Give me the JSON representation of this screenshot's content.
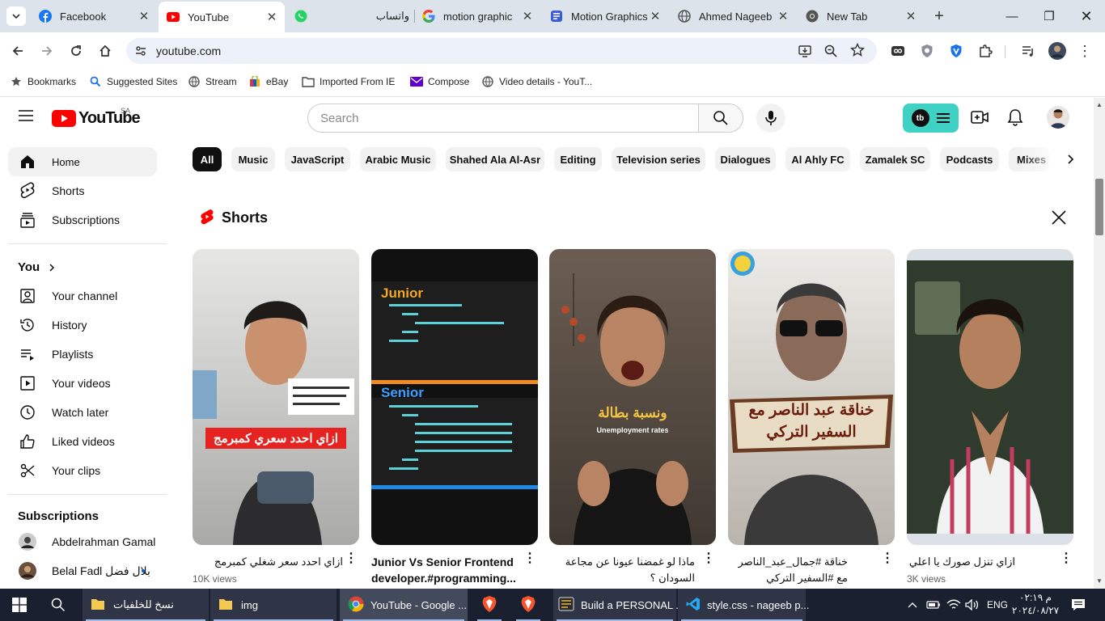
{
  "browser": {
    "tabs": [
      {
        "label": "Facebook",
        "icon": "facebook-icon"
      },
      {
        "label": "YouTube",
        "icon": "youtube-icon",
        "active": true
      },
      {
        "label": "واتساب",
        "icon": "whatsapp-icon"
      },
      {
        "label": "motion graphic",
        "icon": "google-icon"
      },
      {
        "label": "Motion Graphics",
        "icon": "document-icon"
      },
      {
        "label": "Ahmed Nageeb",
        "icon": "globe-icon"
      },
      {
        "label": "New Tab",
        "icon": "chrome-icon"
      }
    ],
    "url": "youtube.com",
    "bookmarks": [
      "Bookmarks",
      "Suggested Sites",
      "Stream",
      "eBay",
      "Imported From IE",
      "Compose",
      "Video details - YouT..."
    ]
  },
  "youtube": {
    "country": "SA",
    "search_placeholder": "Search",
    "sidebar": {
      "main": [
        "Home",
        "Shorts",
        "Subscriptions"
      ],
      "you_label": "You",
      "you_items": [
        "Your channel",
        "History",
        "Playlists",
        "Your videos",
        "Watch later",
        "Liked videos",
        "Your clips"
      ],
      "subscriptions_label": "Subscriptions",
      "subscriptions": [
        {
          "name": "Abdelrahman Gamal"
        },
        {
          "name": "Belal Fadl بلال فضل"
        }
      ]
    },
    "chips": [
      "All",
      "Music",
      "JavaScript",
      "Arabic Music",
      "Shahed Ala Al-Asr",
      "Editing",
      "Television series",
      "Dialogues",
      "Al Ahly FC",
      "Zamalek SC",
      "Podcasts",
      "Mixes"
    ],
    "shorts_label": "Shorts",
    "shorts": [
      {
        "title": "ازاي احدد سعر شغلي كمبرمج",
        "views": "10K views",
        "overlay": "ازاي احدد سعري كمبرمج",
        "rtl": true
      },
      {
        "title": "Junior Vs Senior Frontend developer.#programming...",
        "views": "",
        "overlay_top": "Junior",
        "overlay_bottom": "Senior",
        "rtl": false
      },
      {
        "title": "ماذا لو غمضنا عيونا عن مجاعة السودان ؟",
        "views": "",
        "overlay": "ونسبة بطالة",
        "overlay_sub": "Unemployment rates",
        "rtl": true
      },
      {
        "title": "خناقة #جمال_عبد_الناصر مع #السفير التركي",
        "views": "",
        "overlay": "خناقة عبد الناصر مع السفير التركي",
        "rtl": true
      },
      {
        "title": "ازاي تنزل صورك يا اعلي كوالتي",
        "views": "3K views",
        "rtl": true
      }
    ]
  },
  "taskbar": {
    "items": [
      {
        "label": "نسخ للخلفيات",
        "icon": "folder-icon"
      },
      {
        "label": "img",
        "icon": "folder-icon"
      },
      {
        "label": "YouTube - Google ...",
        "icon": "chrome-icon"
      },
      {
        "label": "",
        "icon": "brave-icon"
      },
      {
        "label": "",
        "icon": "brave-icon"
      },
      {
        "label": "Build a PERSONAL ...",
        "icon": "video-editor-icon"
      },
      {
        "label": "style.css - nageeb p...",
        "icon": "vscode-icon"
      }
    ],
    "lang": "ENG",
    "time": "م ٠٢:١٩",
    "date": "٢٠٢٤/٠٨/٢٧"
  }
}
